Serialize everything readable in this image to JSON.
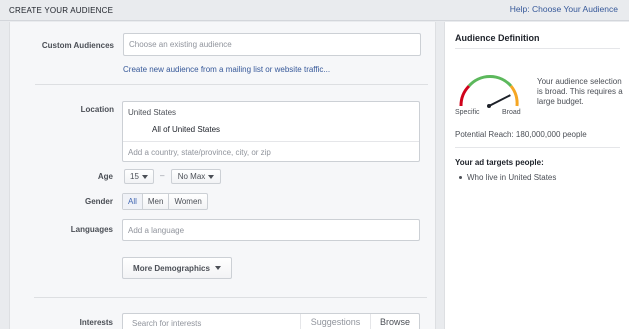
{
  "header": {
    "title": "CREATE YOUR AUDIENCE",
    "help_link": "Help: Choose Your Audience"
  },
  "form": {
    "custom_audiences": {
      "label": "Custom Audiences",
      "placeholder": "Choose an existing audience",
      "create_link": "Create new audience from a mailing list or website traffic..."
    },
    "location": {
      "label": "Location",
      "country": "United States",
      "selected": "All of United States",
      "placeholder": "Add a country, state/province, city, or zip"
    },
    "age": {
      "label": "Age",
      "min": "15",
      "separator": "–",
      "max": "No Max"
    },
    "gender": {
      "label": "Gender",
      "options": [
        "All",
        "Men",
        "Women"
      ],
      "selected": "All"
    },
    "languages": {
      "label": "Languages",
      "placeholder": "Add a language"
    },
    "more_demographics": "More Demographics",
    "interests": {
      "label": "Interests",
      "placeholder": "Search for interests",
      "suggestions": "Suggestions",
      "browse": "Browse"
    }
  },
  "sidebar": {
    "title": "Audience Definition",
    "gauge": {
      "left_label": "Specific",
      "right_label": "Broad",
      "level": 0.85,
      "colors": [
        "#d0021b",
        "#5cb85c",
        "#f5a623"
      ]
    },
    "description": "Your audience selection is broad. This requires a large budget.",
    "potential_reach": "Potential Reach: 180,000,000 people",
    "targets_heading": "Your ad targets people:",
    "targets": [
      "Who live in United States"
    ]
  }
}
